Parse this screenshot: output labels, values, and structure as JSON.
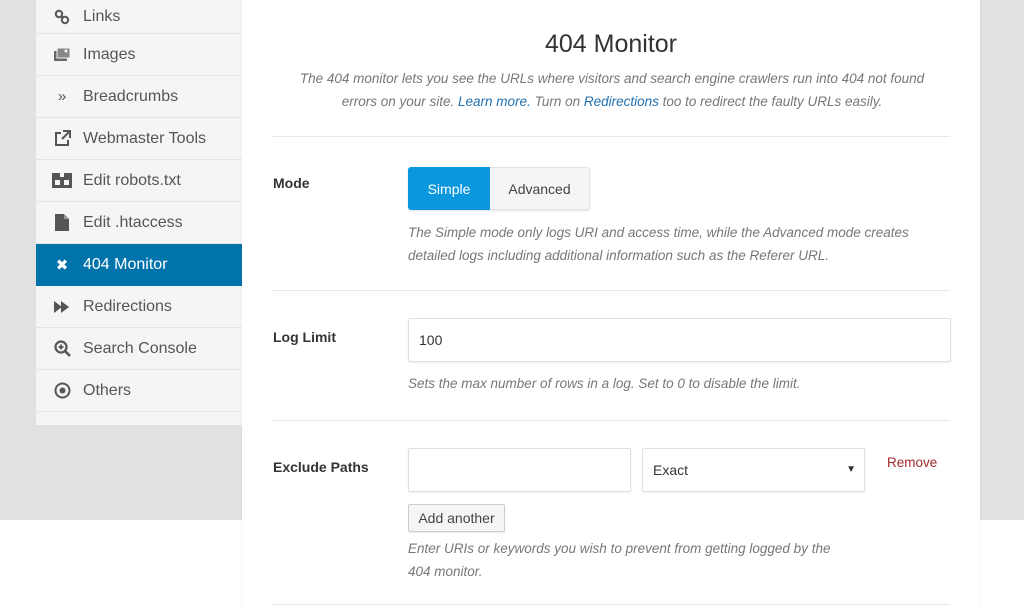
{
  "sidebar": {
    "items": [
      {
        "label": "Links",
        "icon": "link-icon",
        "active": false
      },
      {
        "label": "Images",
        "icon": "images-icon",
        "active": false
      },
      {
        "label": "Breadcrumbs",
        "icon": "double-chevron-right-icon",
        "active": false
      },
      {
        "label": "Webmaster Tools",
        "icon": "external-link-icon",
        "active": false
      },
      {
        "label": "Edit robots.txt",
        "icon": "robot-icon",
        "active": false
      },
      {
        "label": "Edit .htaccess",
        "icon": "file-icon",
        "active": false
      },
      {
        "label": "404 Monitor",
        "icon": "close-icon",
        "active": true
      },
      {
        "label": "Redirections",
        "icon": "fast-forward-icon",
        "active": false
      },
      {
        "label": "Search Console",
        "icon": "search-zoom-icon",
        "active": false
      },
      {
        "label": "Others",
        "icon": "dot-circle-icon",
        "active": false
      }
    ]
  },
  "main": {
    "title": "404 Monitor",
    "intro": {
      "part1": "The 404 monitor lets you see the URLs where visitors and search engine crawlers run into 404 not found errors on your site. ",
      "learn_more": "Learn more.",
      "part2": " Turn on ",
      "redirections_link": "Redirections",
      "part3": " too to redirect the faulty URLs easily."
    },
    "mode": {
      "label": "Mode",
      "options": [
        "Simple",
        "Advanced"
      ],
      "selected": "Simple",
      "description": "The Simple mode only logs URI and access time, while the Advanced mode creates detailed logs including additional information such as the Referer URL."
    },
    "log_limit": {
      "label": "Log Limit",
      "value": "100",
      "description": "Sets the max number of rows in a log. Set to 0 to disable the limit."
    },
    "exclude_paths": {
      "label": "Exclude Paths",
      "path_value": "",
      "match_type": "Exact",
      "remove_label": "Remove",
      "add_label": "Add another",
      "description": "Enter URIs or keywords you wish to prevent from getting logged by the 404 monitor."
    }
  }
}
